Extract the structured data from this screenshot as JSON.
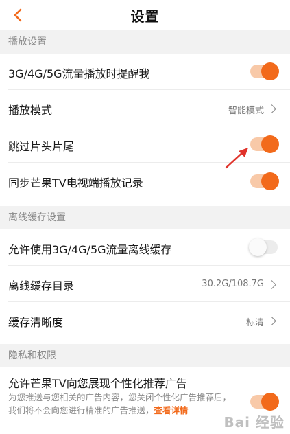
{
  "header": {
    "title": "设置"
  },
  "colors": {
    "accent": "#f26a1b",
    "toggle_track_on": "#f8c9a8",
    "section_bg": "#f2f2f2",
    "annotation_arrow": "#e0322a"
  },
  "sections": {
    "playback": {
      "title": "播放设置",
      "mobile_data_reminder": {
        "label": "3G/4G/5G流量播放时提醒我",
        "on": true
      },
      "play_mode": {
        "label": "播放模式",
        "value": "智能模式"
      },
      "skip_intro": {
        "label": "跳过片头片尾",
        "on": true
      },
      "sync_tv": {
        "label": "同步芒果TV电视端播放记录",
        "on": true
      }
    },
    "offline": {
      "title": "离线缓存设置",
      "allow_mobile_cache": {
        "label": "允许使用3G/4G/5G流量离线缓存",
        "on": false
      },
      "cache_dir": {
        "label": "离线缓存目录",
        "value": "30.2G/108.7G"
      },
      "cache_quality": {
        "label": "缓存清晰度",
        "value": "标清"
      }
    },
    "privacy": {
      "title": "隐私和权限",
      "personalized_ads": {
        "label": "允许芒果TV向您展现个性化推荐广告",
        "description": "为您推送与您相关的广告内容，您关闭个性化广告推荐后，我们将不会向您进行精准的广告推送，",
        "link_text": "查看详情",
        "on": true
      }
    }
  },
  "watermark": "Bai 经验"
}
